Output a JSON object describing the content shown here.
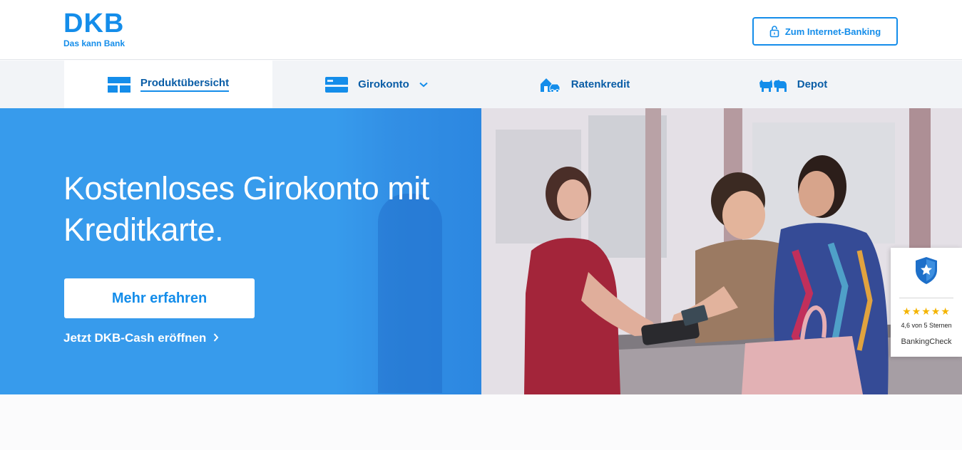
{
  "header": {
    "logo_word": "DKB",
    "logo_claim": "Das kann Bank",
    "login_label": "Zum Internet-Banking",
    "login_icon": "lock-icon"
  },
  "nav": {
    "items": [
      {
        "label": "Produktübersicht",
        "icon": "product-overview-icon",
        "active": true
      },
      {
        "label": "Girokonto",
        "icon": "bank-card-icon",
        "dropdown": true
      },
      {
        "label": "Ratenkredit",
        "icon": "house-car-icon"
      },
      {
        "label": "Depot",
        "icon": "bull-bear-icon"
      }
    ]
  },
  "hero": {
    "title": "Kostenloses Girokonto mit Kreditkarte.",
    "cta_label": "Mehr erfahren",
    "link_label": "Jetzt DKB-Cash eröffnen",
    "photo_description_icon": "shop-payment-photo"
  },
  "rating": {
    "stars": "★★★★★",
    "score_text": "4,6 von 5 Sternen",
    "brand": "BankingCheck",
    "value": 4.6,
    "max": 5
  },
  "colors": {
    "brand_blue": "#148dea",
    "hero_blue": "#379bec",
    "nav_text": "#0a5da6",
    "star_gold": "#f4b400"
  }
}
